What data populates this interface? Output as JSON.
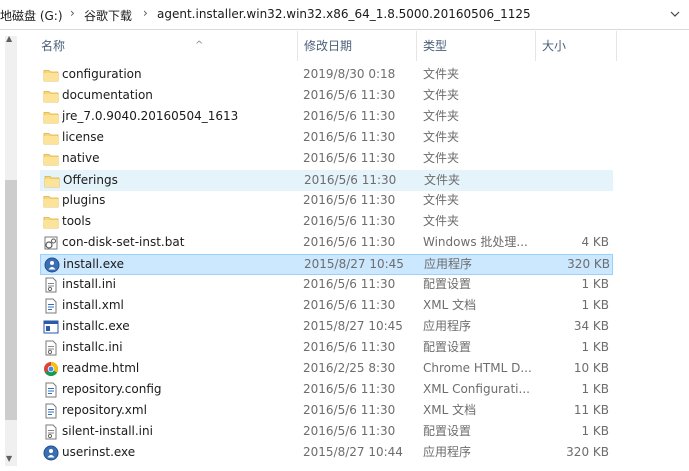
{
  "address": {
    "crumbs": [
      "地磁盘 (G:)",
      "谷歌下载",
      "agent.installer.win32.win32.x86_64_1.8.5000.20160506_1125"
    ],
    "separator": "›",
    "dropdown_icon": "chevron-down-icon"
  },
  "columns": {
    "name": "名称",
    "date": "修改日期",
    "type": "类型",
    "size": "大小"
  },
  "files": [
    {
      "name": "configuration",
      "date": "2019/8/30 0:18",
      "type": "文件夹",
      "size": "",
      "icon": "folder-icon",
      "state": ""
    },
    {
      "name": "documentation",
      "date": "2016/5/6 11:30",
      "type": "文件夹",
      "size": "",
      "icon": "folder-icon",
      "state": ""
    },
    {
      "name": "jre_7.0.9040.20160504_1613",
      "date": "2016/5/6 11:30",
      "type": "文件夹",
      "size": "",
      "icon": "folder-icon",
      "state": ""
    },
    {
      "name": "license",
      "date": "2016/5/6 11:30",
      "type": "文件夹",
      "size": "",
      "icon": "folder-icon",
      "state": ""
    },
    {
      "name": "native",
      "date": "2016/5/6 11:30",
      "type": "文件夹",
      "size": "",
      "icon": "folder-icon",
      "state": ""
    },
    {
      "name": "Offerings",
      "date": "2016/5/6 11:30",
      "type": "文件夹",
      "size": "",
      "icon": "folder-icon",
      "state": "hover"
    },
    {
      "name": "plugins",
      "date": "2016/5/6 11:30",
      "type": "文件夹",
      "size": "",
      "icon": "folder-icon",
      "state": ""
    },
    {
      "name": "tools",
      "date": "2016/5/6 11:30",
      "type": "文件夹",
      "size": "",
      "icon": "folder-icon",
      "state": ""
    },
    {
      "name": "con-disk-set-inst.bat",
      "date": "2016/5/6 11:30",
      "type": "Windows 批处理...",
      "size": "4 KB",
      "icon": "batch-file-icon",
      "state": ""
    },
    {
      "name": "install.exe",
      "date": "2015/8/27 10:45",
      "type": "应用程序",
      "size": "320 KB",
      "icon": "installer-app-icon",
      "state": "selected"
    },
    {
      "name": "install.ini",
      "date": "2016/5/6 11:30",
      "type": "配置设置",
      "size": "1 KB",
      "icon": "config-file-icon",
      "state": ""
    },
    {
      "name": "install.xml",
      "date": "2016/5/6 11:30",
      "type": "XML 文档",
      "size": "1 KB",
      "icon": "xml-file-icon",
      "state": ""
    },
    {
      "name": "installc.exe",
      "date": "2015/8/27 10:45",
      "type": "应用程序",
      "size": "34 KB",
      "icon": "console-app-icon",
      "state": ""
    },
    {
      "name": "installc.ini",
      "date": "2016/5/6 11:30",
      "type": "配置设置",
      "size": "1 KB",
      "icon": "config-file-icon",
      "state": ""
    },
    {
      "name": "readme.html",
      "date": "2016/2/25 8:30",
      "type": "Chrome HTML D...",
      "size": "10 KB",
      "icon": "chrome-icon",
      "state": ""
    },
    {
      "name": "repository.config",
      "date": "2016/5/6 11:30",
      "type": "XML Configurati...",
      "size": "1 KB",
      "icon": "xml-file-icon",
      "state": ""
    },
    {
      "name": "repository.xml",
      "date": "2016/5/6 11:30",
      "type": "XML 文档",
      "size": "11 KB",
      "icon": "xml-file-icon",
      "state": ""
    },
    {
      "name": "silent-install.ini",
      "date": "2016/5/6 11:30",
      "type": "配置设置",
      "size": "1 KB",
      "icon": "config-file-icon",
      "state": ""
    },
    {
      "name": "userinst.exe",
      "date": "2015/8/27 10:44",
      "type": "应用程序",
      "size": "320 KB",
      "icon": "installer-app-icon",
      "state": ""
    }
  ]
}
